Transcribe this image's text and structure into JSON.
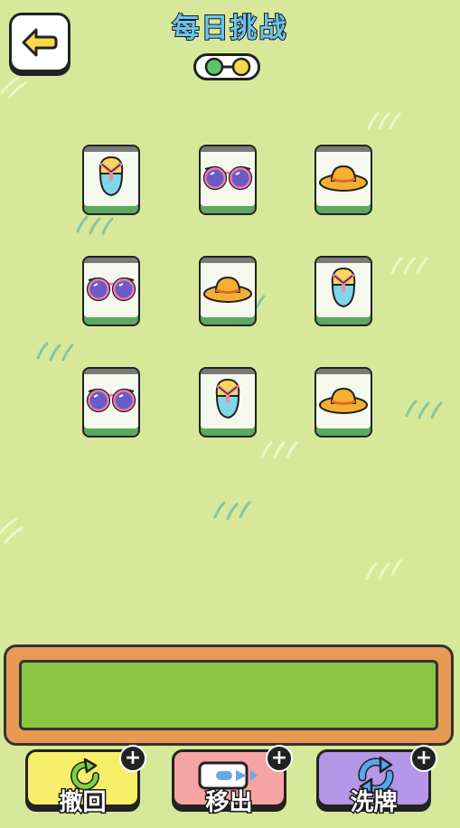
{
  "header": {
    "title": "每日挑战",
    "back_icon": "back-arrow-icon",
    "toggle_icon": "level-toggle-icon"
  },
  "board": {
    "tiles": [
      {
        "icon": "flip-flop"
      },
      {
        "icon": "sunglasses"
      },
      {
        "icon": "sun-hat"
      },
      {
        "icon": "sunglasses"
      },
      {
        "icon": "sun-hat"
      },
      {
        "icon": "flip-flop"
      },
      {
        "icon": "sunglasses"
      },
      {
        "icon": "flip-flop"
      },
      {
        "icon": "sun-hat"
      }
    ]
  },
  "tray": {
    "slots": []
  },
  "toolbar": {
    "undo_label": "撤回",
    "remove_label": "移出",
    "shuffle_label": "洗牌",
    "add_label": "+"
  },
  "colors": {
    "background": "#d8e89a",
    "title": "#69c4f0",
    "tray_frame": "#e89a55",
    "tray_inner": "#8bc443",
    "undo_button": "#f7ef6a",
    "remove_button": "#f5a3a3",
    "shuffle_button": "#b596e8"
  }
}
